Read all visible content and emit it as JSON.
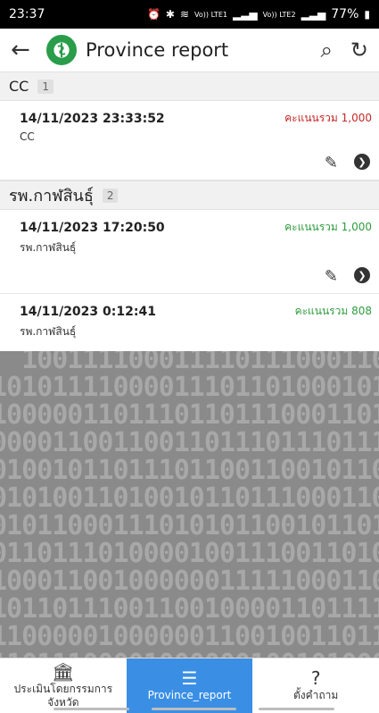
{
  "status_bar": {
    "time": "23:37",
    "icons": [
      "alarm-icon",
      "bluetooth-icon",
      "wifi-icon",
      "signal-icon",
      "signal-icon"
    ],
    "network1": "Vo)) LTE1",
    "network2": "Vo)) LTE2",
    "battery": "77%"
  },
  "app_bar": {
    "title": "Province report",
    "back_icon": "arrow-left-icon",
    "search_icon": "search-icon",
    "refresh_icon": "refresh-icon"
  },
  "groups": [
    {
      "name": "CC",
      "count": "1",
      "items": [
        {
          "date": "14/11/2023 23:33:52",
          "sub": "CC",
          "score": "คะแนนรวม 1,000",
          "score_color": "#c62828"
        }
      ]
    },
    {
      "name": "รพ.กาฬสินธุ์",
      "count": "2",
      "items": [
        {
          "date": "14/11/2023 17:20:50",
          "sub": "รพ.กาฬสินธุ์",
          "score": "คะแนนรวม 1,000",
          "score_color": "#2e9d3e"
        },
        {
          "date": "14/11/2023 0:12:41",
          "sub": "รพ.กาฬสินธุ์",
          "score": "คะแนนรวม 808",
          "score_color": "#2e9d3e"
        }
      ]
    }
  ],
  "bottom_nav": [
    {
      "label": "ประเมินโดยกรรมการจังหวัด",
      "icon": "bank-icon",
      "active": false
    },
    {
      "label": "Province_report",
      "icon": "list-icon",
      "active": true
    },
    {
      "label": "ตั้งคำถาม",
      "icon": "question-icon",
      "active": false
    }
  ]
}
